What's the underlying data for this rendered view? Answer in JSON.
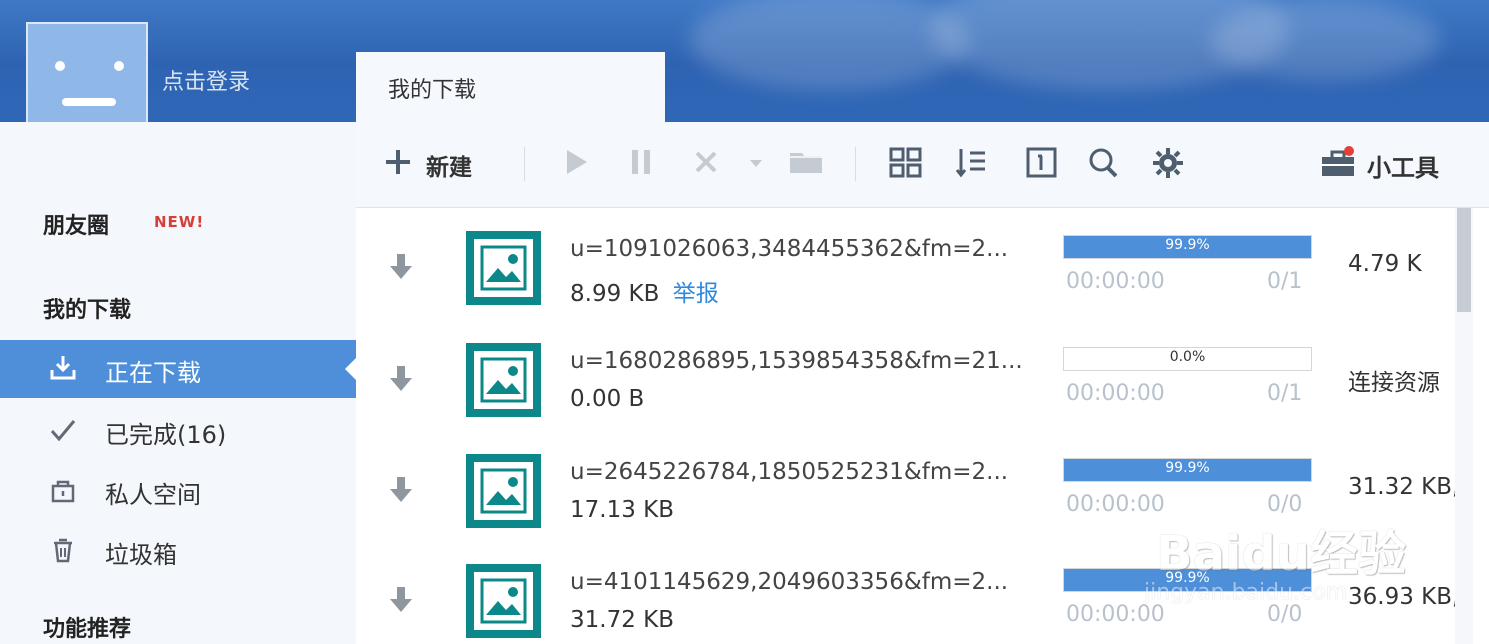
{
  "header": {
    "login_label": "点击登录",
    "tab_label": "我的下载"
  },
  "sidebar": {
    "friends_title": "朋友圈",
    "new_badge": "NEW!",
    "downloads_title": "我的下载",
    "items": [
      {
        "label": "正在下载",
        "icon": "download-icon"
      },
      {
        "label": "已完成(16)",
        "icon": "check-icon"
      },
      {
        "label": "私人空间",
        "icon": "lock-icon"
      },
      {
        "label": "垃圾箱",
        "icon": "trash-icon"
      }
    ],
    "recommend_title": "功能推荐"
  },
  "toolbar": {
    "new_label": "新建",
    "mini_tools_label": "小工具",
    "icons": [
      "plus-icon",
      "play-icon",
      "pause-icon",
      "delete-icon",
      "dropdown-icon",
      "folder-icon",
      "grid-icon",
      "sort-icon",
      "info-icon",
      "search-icon",
      "gear-icon",
      "toolbox-icon"
    ]
  },
  "downloads": [
    {
      "name": "u=1091026063,3484455362&fm=2...",
      "size": "8.99 KB",
      "report": "举报",
      "progress_text": "99.9%",
      "progress": 0.999,
      "eta": "00:00:00",
      "count": "0/1",
      "speed": "4.79  K"
    },
    {
      "name": "u=1680286895,1539854358&fm=21...",
      "size": "0.00 B",
      "report": "",
      "progress_text": "0.0%",
      "progress": 0.0,
      "eta": "00:00:00",
      "count": "0/1",
      "speed": "连接资源"
    },
    {
      "name": "u=2645226784,1850525231&fm=2...",
      "size": "17.13 KB",
      "report": "",
      "progress_text": "99.9%",
      "progress": 0.999,
      "eta": "00:00:00",
      "count": "0/0",
      "speed": "31.32  KB,"
    },
    {
      "name": "u=4101145629,2049603356&fm=2...",
      "size": "31.72 KB",
      "report": "",
      "progress_text": "99.9%",
      "progress": 0.999,
      "eta": "00:00:00",
      "count": "0/0",
      "speed": "36.93  KB,"
    }
  ],
  "watermark": {
    "brand": "Baidu经验",
    "url": "jingyan.baidu.com"
  },
  "colors": {
    "header_blue": "#2e63b2",
    "active_blue": "#4f8ed8",
    "progress_blue": "#4e8fd9",
    "teal_thumb": "#0c888a",
    "link_blue": "#2e89df",
    "new_red": "#d63f39"
  }
}
